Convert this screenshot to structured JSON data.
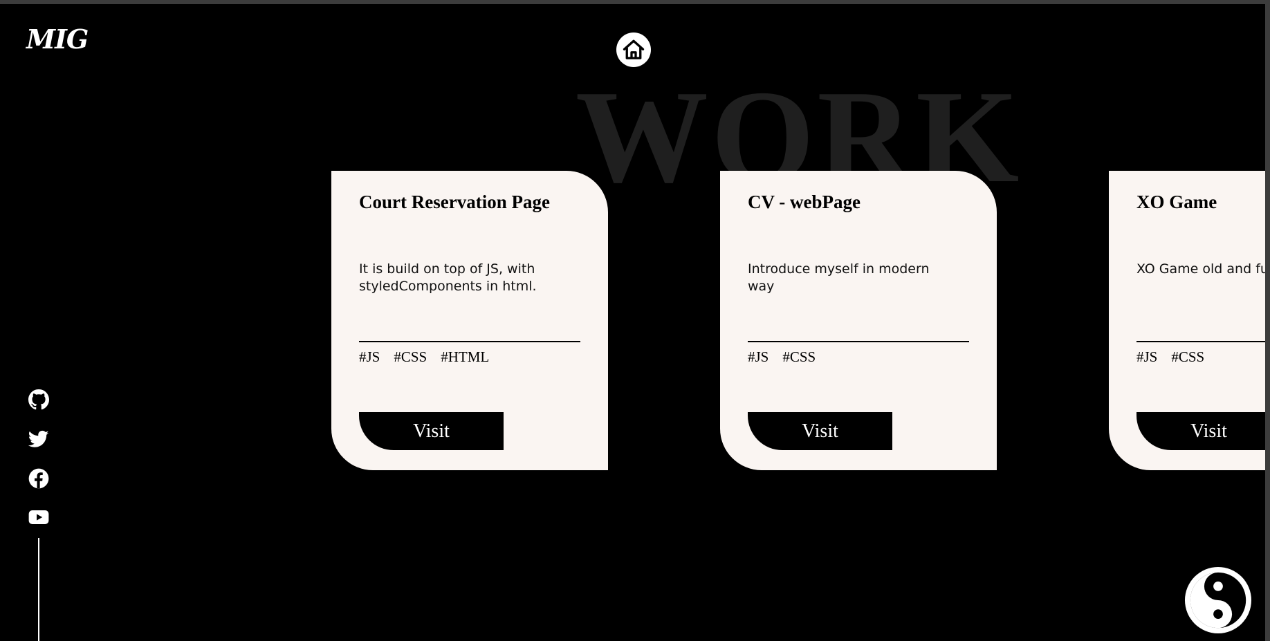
{
  "logo": {
    "text": "MIG"
  },
  "background_title": "WORK",
  "nav": {
    "home_icon": "home-icon"
  },
  "social_links": [
    {
      "name": "github",
      "icon": "github-icon"
    },
    {
      "name": "twitter",
      "icon": "twitter-icon"
    },
    {
      "name": "facebook",
      "icon": "facebook-icon"
    },
    {
      "name": "youtube",
      "icon": "youtube-icon"
    }
  ],
  "projects": [
    {
      "title": "Court Reservation Page",
      "description": "It is build on top of JS, with styledComponents in html.",
      "tags": [
        "#JS",
        "#CSS",
        "#HTML"
      ],
      "button_label": "Visit"
    },
    {
      "title": "CV - webPage",
      "description": "Introduce myself in modern way",
      "tags": [
        "#JS",
        "#CSS"
      ],
      "button_label": "Visit"
    },
    {
      "title": "XO Game",
      "description": "XO Game old and fun game",
      "tags": [
        "#JS",
        "#CSS"
      ],
      "button_label": "Visit"
    }
  ],
  "theme_toggle": {
    "icon": "yin-yang-icon"
  },
  "colors": {
    "background": "#000000",
    "card": "#faf5f2",
    "watermark": "#1f1f1f",
    "accent": "#ffffff"
  }
}
